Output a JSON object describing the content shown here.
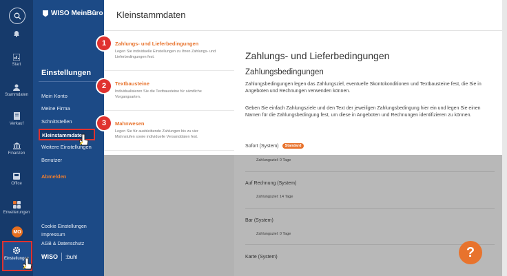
{
  "rail": {
    "items": [
      {
        "label": "",
        "icon": "bell-icon"
      },
      {
        "label": "Start",
        "icon": "chart-icon"
      },
      {
        "label": "Stammdaten",
        "icon": "person-icon"
      },
      {
        "label": "Verkauf",
        "icon": "document-icon"
      },
      {
        "label": "Finanzen",
        "icon": "bank-icon"
      },
      {
        "label": "Office",
        "icon": "inbox-icon"
      },
      {
        "label": "Erweiterungen",
        "icon": "grid-icon"
      },
      {
        "label": "Einstellungen",
        "icon": "gear-icon"
      }
    ],
    "avatar": "MO"
  },
  "app": {
    "logo": "WISO MeinBüro"
  },
  "settings": {
    "title": "Einstellungen",
    "menu": [
      {
        "label": "Mein Konto"
      },
      {
        "label": "Meine Firma"
      },
      {
        "label": "Schnittstellen"
      },
      {
        "label": "Kleinstammdaten"
      },
      {
        "label": "Weitere Einstellungen"
      },
      {
        "label": "Benutzer"
      },
      {
        "label": "Abmelden"
      }
    ],
    "footer": [
      "Cookie Einstellungen",
      "Impressum",
      "AGB & Datenschutz"
    ],
    "brand": {
      "wiso": "WISO",
      "buhl": ":buhl"
    }
  },
  "page": {
    "title": "Kleinstammdaten"
  },
  "categories": [
    {
      "num": "1",
      "title": "Zahlungs- und Lieferbedingungen",
      "desc": "Legen Sie individuelle Einstellungen zu Ihren Zahlungs- und Lieferbedingungen fest."
    },
    {
      "num": "2",
      "title": "Textbausteine",
      "desc": "Individualisieren Sie die Textbausteine für sämtliche Vorgangsarten."
    },
    {
      "num": "3",
      "title": "Mahnwesen",
      "desc": "Legen Sie für ausbleibende Zahlungen bis zu vier Mahnstufen sowie individuelle Versanddaten fest."
    }
  ],
  "detail": {
    "heading": "Zahlungs- und Lieferbedingungen",
    "subheading": "Zahlungsbedingungen",
    "para1": "Zahlungsbedingungen legen das Zahlungsziel, eventuelle Skontokonditionen und Textbausteine fest, die Sie in Angeboten und Rechnungen verwenden können.",
    "para2": "Geben Sie einfach Zahlungsziele und den Text der jeweiligen Zahlungsbedingung hier ein und legen Sie einen Namen für die Zahlungsbedingung fest, um diese in Angeboten und Rechnungen identifizieren zu können.",
    "conditions": [
      {
        "name": "Sofort (System)",
        "badge": "Standard",
        "sub": "Zahlungsziel: 0 Tage"
      },
      {
        "name": "Auf Rechnung (System)",
        "badge": "",
        "sub": "Zahlungsziel: 14 Tage"
      },
      {
        "name": "Bar (System)",
        "badge": "",
        "sub": "Zahlungsziel: 0 Tage"
      },
      {
        "name": "Karte (System)",
        "badge": "",
        "sub": ""
      }
    ]
  },
  "help": {
    "label": "?"
  },
  "colors": {
    "rail": "#163a6b",
    "settings": "#1c4a86",
    "accent": "#e8732d",
    "highlight": "#e0322f"
  }
}
